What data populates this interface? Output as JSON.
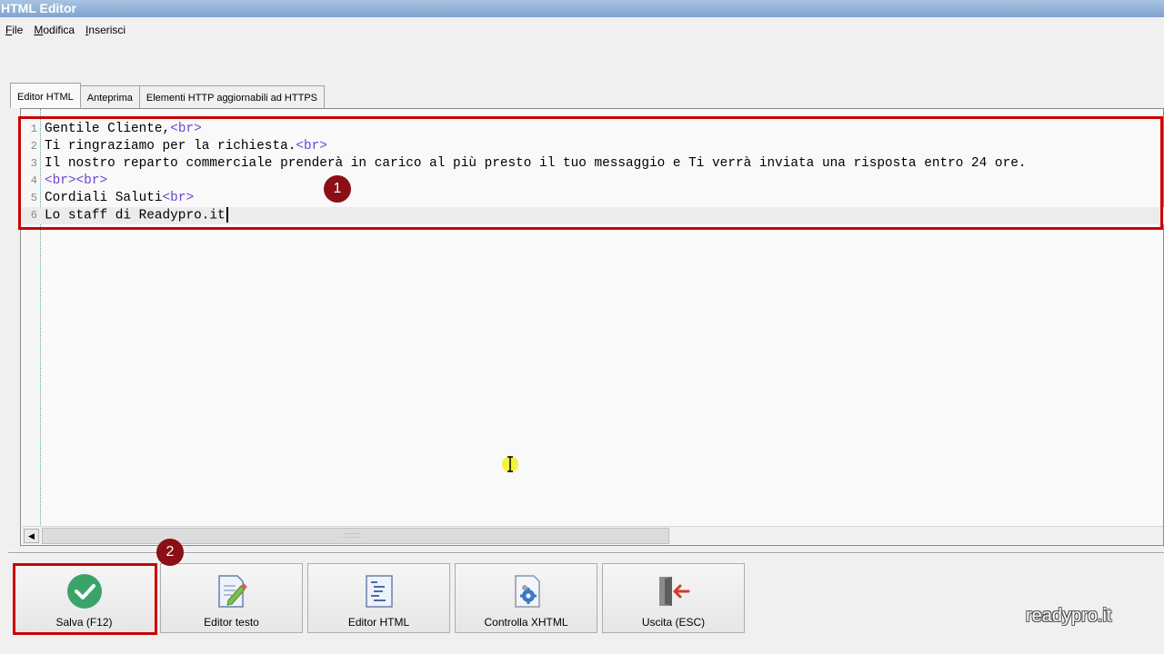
{
  "window": {
    "title": "HTML Editor"
  },
  "menu": {
    "items": [
      {
        "underline": "F",
        "rest": "ile"
      },
      {
        "underline": "M",
        "rest": "odifica"
      },
      {
        "underline": "I",
        "rest": "nserisci"
      }
    ]
  },
  "tabs": [
    {
      "label": "Editor HTML",
      "active": true
    },
    {
      "label": "Anteprima",
      "active": false
    },
    {
      "label": "Elementi HTTP aggiornabili ad HTTPS",
      "active": false
    }
  ],
  "editor": {
    "lines": [
      {
        "num": "1",
        "text": "Gentile Cliente,",
        "tag": "<br>"
      },
      {
        "num": "2",
        "text": "Ti ringraziamo per la richiesta.",
        "tag": "<br>"
      },
      {
        "num": "3",
        "text": "Il nostro reparto commerciale prenderà in carico al più presto il tuo messaggio e Ti verrà inviata una risposta entro 24 ore.",
        "tag": ""
      },
      {
        "num": "4",
        "text": "",
        "tag": "<br><br>"
      },
      {
        "num": "5",
        "text": "Cordiali Saluti",
        "tag": "<br>"
      },
      {
        "num": "6",
        "text": "Lo staff di Readypro.it",
        "tag": ""
      }
    ],
    "scroll_grip": "::::::"
  },
  "callouts": {
    "one": "1",
    "two": "2"
  },
  "buttons": {
    "save": "Salva (F12)",
    "text_editor": "Editor testo",
    "html_editor": "Editor HTML",
    "check_xhtml": "Controlla XHTML",
    "exit": "Uscita (ESC)"
  },
  "brand": "readypro.it",
  "icons": {
    "save": "check-circle-icon",
    "text_editor": "document-pencil-icon",
    "html_editor": "document-list-icon",
    "check_xhtml": "document-gear-icon",
    "exit": "exit-door-icon",
    "scroll_left": "arrow-left-icon"
  },
  "colors": {
    "accent_red": "#cc0000",
    "callout": "#8b0f14",
    "tag": "#6b46d6",
    "save_green": "#3aa36a"
  }
}
